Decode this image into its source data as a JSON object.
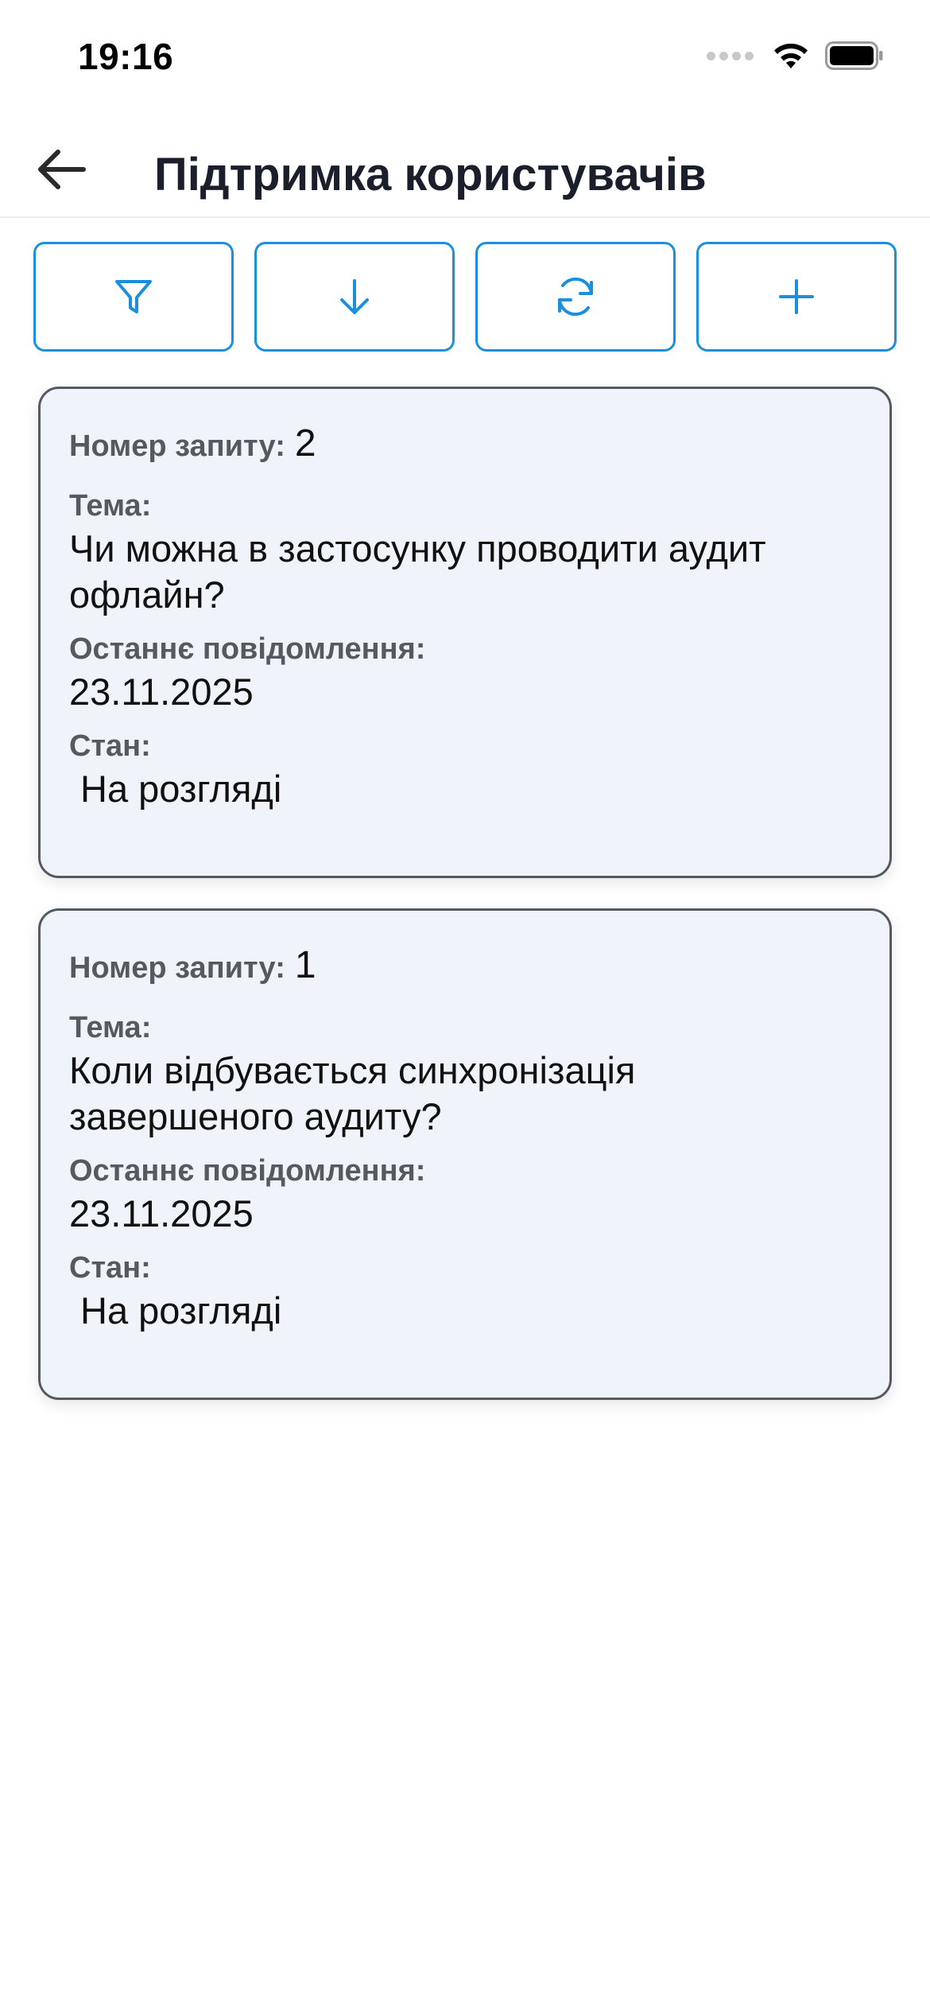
{
  "status_bar": {
    "time": "19:16",
    "icons": [
      "signal-icon",
      "wifi-icon",
      "battery-icon"
    ]
  },
  "header": {
    "back_icon": "arrow-left-icon",
    "title": "Підтримка користувачів"
  },
  "toolbar": {
    "buttons": [
      {
        "icon": "filter-icon"
      },
      {
        "icon": "arrow-down-icon"
      },
      {
        "icon": "refresh-icon"
      },
      {
        "icon": "plus-icon"
      }
    ],
    "accent_color": "#1a8fe0"
  },
  "requests": [
    {
      "number_label": "Номер запиту:",
      "number": "2",
      "subject_label": "Тема:",
      "subject": "Чи можна в застосунку проводити аудит офлайн?",
      "last_message_label": "Останнє повідомлення:",
      "last_message": "23.11.2025",
      "status_label": "Стан:",
      "status": "На розгляді"
    },
    {
      "number_label": "Номер запиту:",
      "number": "1",
      "subject_label": "Тема:",
      "subject": "Коли відбувається синхронізація завершеного аудиту?",
      "last_message_label": "Останнє повідомлення:",
      "last_message": "23.11.2025",
      "status_label": "Стан:",
      "status": "На розгляді"
    }
  ],
  "colors": {
    "card_background": "#f0f4fa",
    "card_border": "#555a61",
    "label_color": "#555a61"
  }
}
